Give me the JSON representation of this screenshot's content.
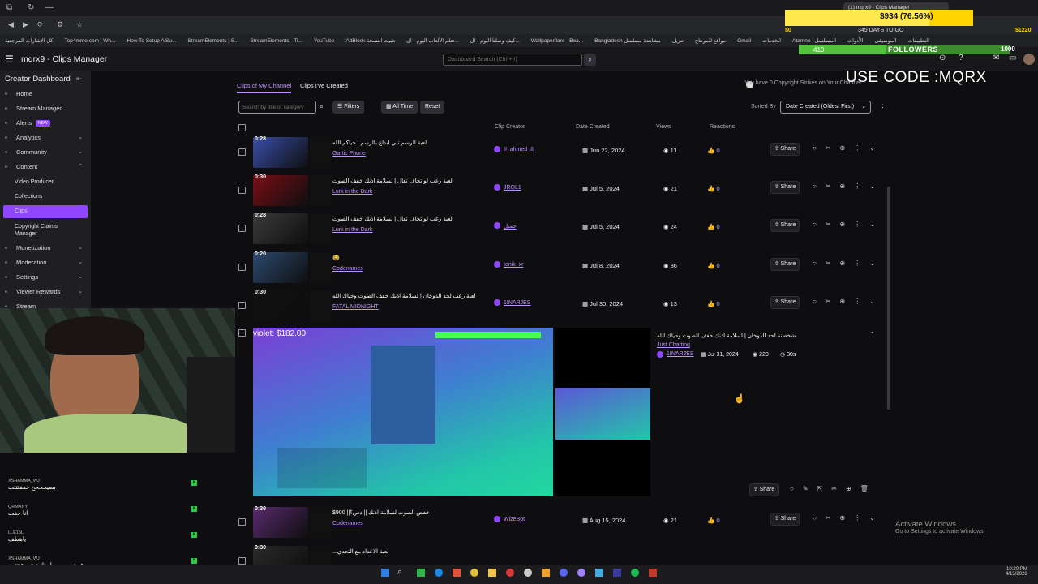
{
  "browser": {
    "tab_title": "(1) mqrx9 - Clips Manager",
    "bookmarks": [
      "كل الإشارات المرجعية",
      "Top4mme.com | Wh...",
      "How To Setup A Su...",
      "StreamElements | S...",
      "StreamElements - Ti...",
      "YouTube",
      "AdBlock تثبيت النسخة",
      "تعلم الألعاب اليوم - ال...",
      "كيف وصلنا اليوم - ال...",
      "Wallpaperflare - Bea...",
      "Bangladesh مشاهدة مسلسل",
      "تنزيل",
      "مواقع للمونتاج",
      "Gmail",
      "الخدمات",
      "Atamno | المسلسل",
      "الأدوات",
      "الموسيقى",
      "التطبيقات"
    ]
  },
  "app": {
    "title": "mqrx9 - Clips Manager",
    "search_placeholder": "Dashboard Search (Ctrl + /)"
  },
  "sidebar": {
    "header": "Creator Dashboard",
    "items": [
      {
        "label": "Home",
        "icon": "home-icon"
      },
      {
        "label": "Stream Manager",
        "icon": "stream-manager-icon"
      },
      {
        "label": "Alerts",
        "icon": "alerts-icon",
        "badge": "NEW"
      },
      {
        "label": "Analytics",
        "icon": "analytics-icon"
      },
      {
        "label": "Community",
        "icon": "community-icon"
      },
      {
        "label": "Content",
        "icon": "content-icon"
      }
    ],
    "content_sub": [
      "Video Producer",
      "Collections",
      "Clips",
      "Copyright Claims Manager"
    ],
    "items2": [
      {
        "label": "Monetization",
        "icon": "monetization-icon"
      },
      {
        "label": "Moderation",
        "icon": "moderation-icon"
      },
      {
        "label": "Settings",
        "icon": "settings-icon"
      },
      {
        "label": "Viewer Rewards",
        "icon": "rewards-icon"
      },
      {
        "label": "Stream",
        "icon": "stream-icon"
      }
    ]
  },
  "tabs": [
    "Clips of My Channel",
    "Clips I've Created"
  ],
  "copyright_notice": "You have 0 Copyright Strikes on Your Channel",
  "toolbar": {
    "search_placeholder": "Search by title or category",
    "filters": "Filters",
    "all_time": "All Time",
    "reset": "Reset",
    "sorted_by_label": "Sorted By",
    "sort_value": "Date Created (Oldest First)"
  },
  "table": {
    "headers": {
      "creator": "Clip Creator",
      "date": "Date Created",
      "views": "Views",
      "reactions": "Reactions"
    },
    "share_label": "Share",
    "rows": [
      {
        "duration": "0:28",
        "title": "لعبة الرسم تبي ابداع بالرسم | حياكم الله",
        "game": "Gartic Phone",
        "creator": "II_ahmed_II",
        "date": "Jun 22, 2024",
        "views": "11",
        "reactions": "0",
        "color": "#3a4fa8"
      },
      {
        "duration": "0:30",
        "title": "لعبة رعب لو تخاف تعال | لسلامة اذنك خفف الصوت",
        "game": "Lurk in the Dark",
        "creator": "JRQL1",
        "date": "Jul 5, 2024",
        "views": "21",
        "reactions": "0",
        "color": "#7a0e14"
      },
      {
        "duration": "0:28",
        "title": "لعبة رعب لو تخاف تعال | لسلامة اذنك خفف الصوت",
        "game": "Lurk in the Dark",
        "creator": "جميل",
        "date": "Jul 5, 2024",
        "views": "24",
        "reactions": "0",
        "color": "#3b3b3b"
      },
      {
        "duration": "0:20",
        "title": "😂",
        "game": "Codenames",
        "creator": "tonik_xr",
        "date": "Jul 8, 2024",
        "views": "36",
        "reactions": "0",
        "color": "#2c4a6e"
      },
      {
        "duration": "0:30",
        "title": "لعبة رعب لحد الدوخان | لسلامة اذنك خفف الصوت وحياك الله",
        "game": "FATAL MIDNIGHT",
        "creator": "1INARJES",
        "date": "Jul 30, 2024",
        "views": "13",
        "reactions": "0",
        "color": "#111111"
      }
    ],
    "expanded": {
      "title": "شخصنة لحد الدوخان | لسلامة اذنك خفف الصوت وحياك الله",
      "game": "Just Chatting",
      "creator": "1INARJES",
      "date": "Jul 31, 2024",
      "views": "220",
      "duration": "30s",
      "overlay_text": "violet: $182.00"
    },
    "rows_after": [
      {
        "duration": "0:30",
        "title": "خفض الصوت لسلامة اذنك || دس؟|| 900$",
        "game": "Codenames",
        "creator": "WizeBot",
        "date": "Aug 15, 2024",
        "views": "21",
        "reactions": "0",
        "color": "#5a2a6e"
      },
      {
        "duration": "0:30",
        "title": "لعبة الاعداد مع التحدي...",
        "game": "",
        "creator": "",
        "date": "",
        "views": "",
        "reactions": "",
        "color": "#2a2a2a"
      }
    ]
  },
  "stream_overlay": {
    "money": "$934 (76.56%)",
    "days_to_go": "345 DAYS TO GO",
    "goal_left": "$0",
    "goal_right": "$1220",
    "followers_label": "FOLLOWERS",
    "followers_left": "410",
    "followers_right": "1000",
    "code_text": "USE CODE :MQRX",
    "goal_progress": 0.7656,
    "followers_progress": 0.41
  },
  "chat": [
    {
      "user": "XSHAMMA_WJ",
      "text": "بصيحححح خففتتتت"
    },
    {
      "user": "QRMANY",
      "text": "انا خفت"
    },
    {
      "user": "LLE15L",
      "text": "ياهطف"
    },
    {
      "user": "XSHAMMA_WJ",
      "text": "غبية سرحت ل ثانية غررعتتتيي"
    }
  ],
  "watermark": {
    "title": "Activate Windows",
    "subtitle": "Go to Settings to activate Windows."
  },
  "taskbar": {
    "time": "10:20 PM",
    "date": "4/15/2026"
  }
}
